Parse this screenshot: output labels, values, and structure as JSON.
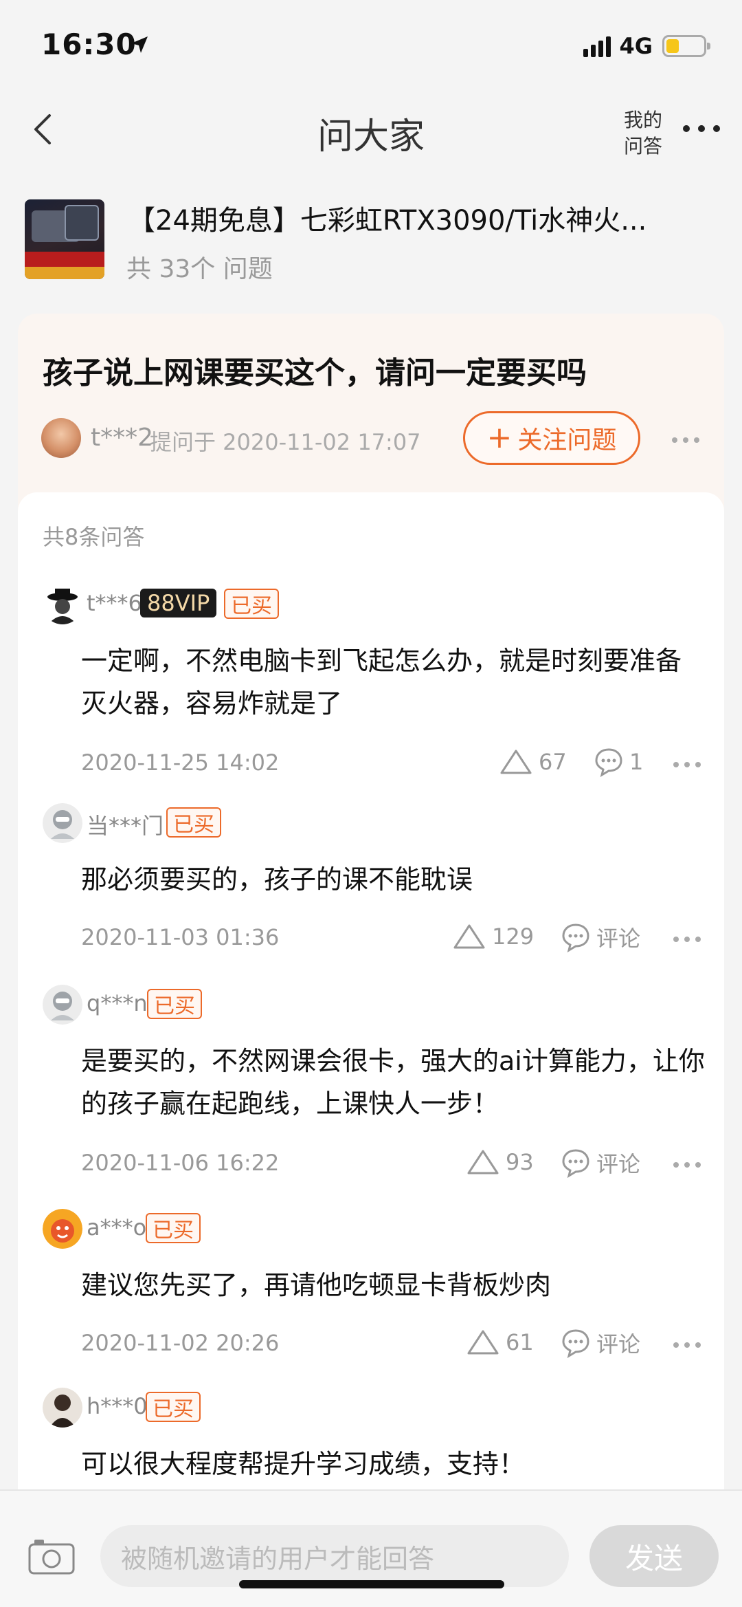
{
  "status_bar": {
    "time": "16:30",
    "carrier": "4G",
    "battery_color": "#f6c619"
  },
  "nav": {
    "title": "问大家",
    "my_qa_line1": "我的",
    "my_qa_line2": "问答"
  },
  "product": {
    "title": "【24期免息】七彩虹RTX3090/Ti水神火...",
    "question_count": "共 33个 问题"
  },
  "question": {
    "title": "孩子说上网课要买这个，请问一定要买吗",
    "asker": "t***2",
    "meta": "提问于 2020-11-02 17:07",
    "follow_label": "关注问题"
  },
  "answers_header": "共8条问答",
  "answers": [
    {
      "user": "t***6",
      "vip": "88VIP",
      "bought": "已买",
      "text": "一定啊，不然电脑卡到飞起怎么办，就是时刻要准备灭火器，容易炸就是了",
      "date": "2020-11-25 14:02",
      "likes": "67",
      "comments": "1"
    },
    {
      "user": "当***门",
      "bought": "已买",
      "text": "那必须要买的，孩子的课不能耽误",
      "date": "2020-11-03 01:36",
      "likes": "129",
      "comments": "评论"
    },
    {
      "user": "q***n",
      "bought": "已买",
      "text": "是要买的，不然网课会很卡，强大的ai计算能力，让你的孩子赢在起跑线，上课快人一步！",
      "date": "2020-11-06 16:22",
      "likes": "93",
      "comments": "评论"
    },
    {
      "user": "a***o",
      "bought": "已买",
      "text": "建议您先买了，再请他吃顿显卡背板炒肉",
      "date": "2020-11-02 20:26",
      "likes": "61",
      "comments": "评论"
    },
    {
      "user": "h***0",
      "bought": "已买",
      "text": "可以很大程度帮提升学习成绩，支持！"
    }
  ],
  "bottom_bar": {
    "placeholder": "被随机邀请的用户才能回答",
    "send_label": "发送"
  },
  "colors": {
    "accent": "#ec6a2a",
    "vip_bg": "#1b1b1b",
    "vip_text": "#f4d9a8"
  }
}
